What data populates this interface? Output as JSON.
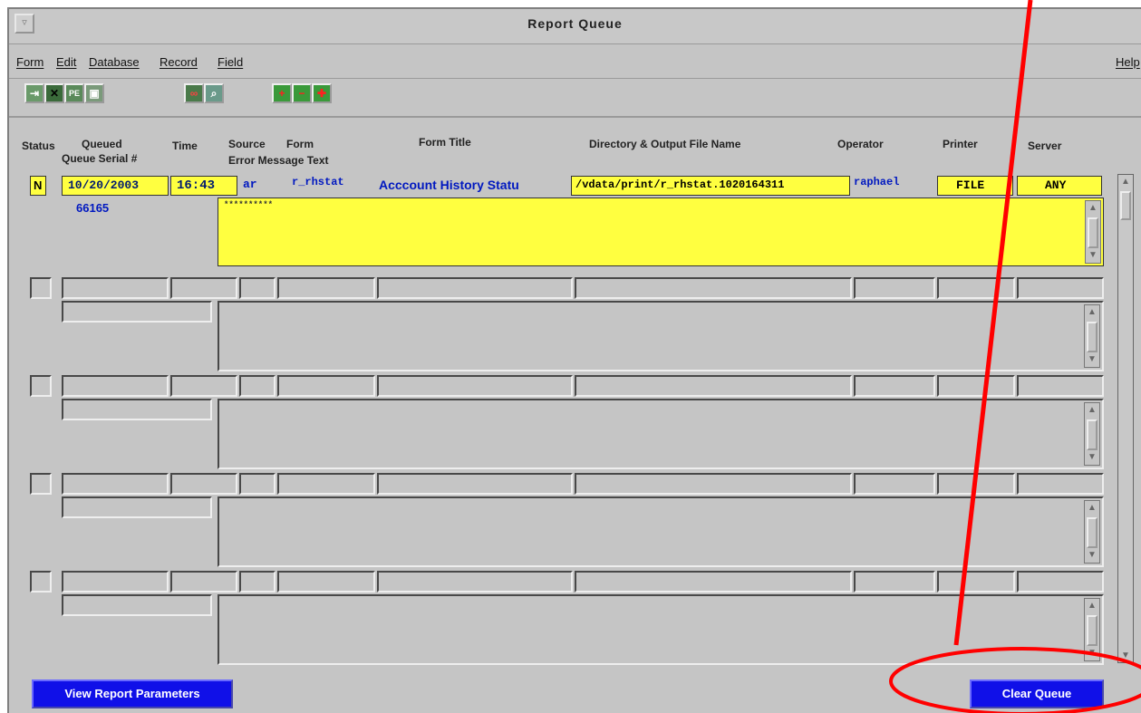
{
  "window": {
    "title": "Report Queue"
  },
  "menu": [
    "Form",
    "Edit",
    "Database",
    "Record",
    "Field",
    "Help"
  ],
  "toolbar": [
    {
      "name": "exit-icon",
      "glyph": "⇥"
    },
    {
      "name": "cancel-icon",
      "glyph": "✕"
    },
    {
      "name": "pe-icon",
      "glyph": "PE"
    },
    {
      "name": "print-icon",
      "glyph": "▣"
    },
    {
      "name": "query-icon",
      "glyph": "∞"
    },
    {
      "name": "search-icon",
      "glyph": "⌕"
    },
    {
      "name": "add-record-icon",
      "glyph": "+"
    },
    {
      "name": "delete-record-icon",
      "glyph": "−"
    },
    {
      "name": "duplicate-record-icon",
      "glyph": "✚"
    }
  ],
  "headers": {
    "status": "Status",
    "queued": "Queued",
    "time": "Time",
    "source": "Source",
    "form": "Form",
    "form_title": "Form Title",
    "directory": "Directory & Output File Name",
    "operator": "Operator",
    "printer": "Printer",
    "server": "Server",
    "queue_serial": "Queue Serial #",
    "error_message": "Error Message Text"
  },
  "record": {
    "status": "N",
    "queued": "10/20/2003",
    "time": "16:43",
    "source": "ar",
    "form": "r_rhstat",
    "form_title": "Acccount History Statu",
    "directory": "/vdata/print/r_rhstat.1020164311",
    "operator": "raphael",
    "printer": "FILE",
    "server": "ANY",
    "queue_serial": "66165",
    "error_message": "**********"
  },
  "buttons": {
    "view_params": "View Report Parameters",
    "clear_queue": "Clear Queue"
  },
  "colors": {
    "active_row": "#ffff40",
    "button": "#1010e8",
    "annotation": "#ff0000"
  }
}
